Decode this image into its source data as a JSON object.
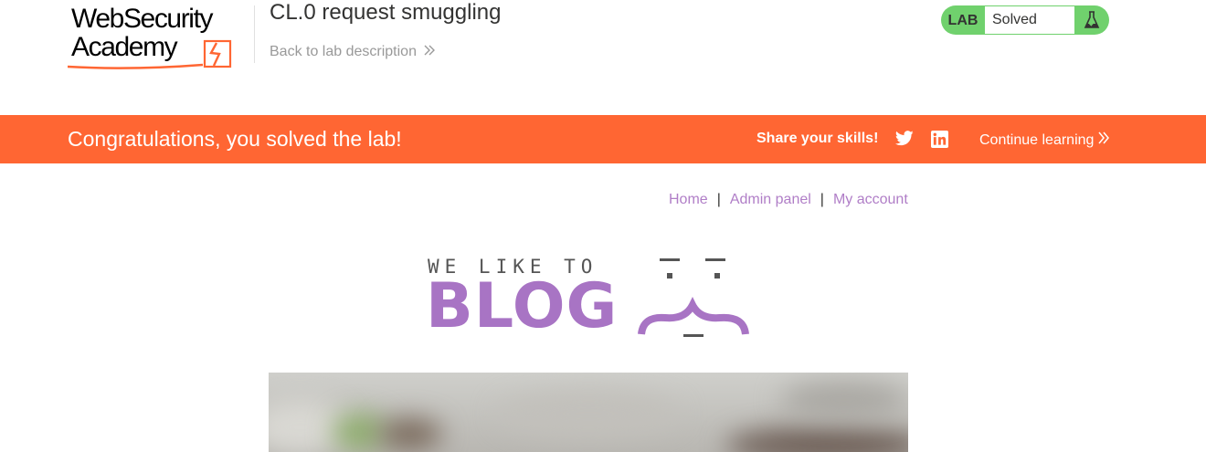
{
  "logo": {
    "line1": "WebSecurity",
    "line2": "Academy"
  },
  "lab": {
    "title": "CL.0 request smuggling",
    "back_label": "Back to lab description",
    "tag": "LAB",
    "status": "Solved",
    "status_color": "#70d16d"
  },
  "banner": {
    "message": "Congratulations, you solved the lab!",
    "share_label": "Share your skills!",
    "continue_label": "Continue learning",
    "color": "#ff6633"
  },
  "nav": {
    "home": "Home",
    "admin": "Admin panel",
    "account": "My account",
    "separator": "|"
  },
  "blog_logo": {
    "tagline": "WE LIKE TO",
    "word": "BLOG",
    "accent": "#a874c4"
  },
  "icons": {
    "back": "double-chevron-right-icon",
    "flask": "flask-icon",
    "twitter": "twitter-icon",
    "linkedin": "linkedin-icon",
    "continue": "double-chevron-right-icon"
  }
}
